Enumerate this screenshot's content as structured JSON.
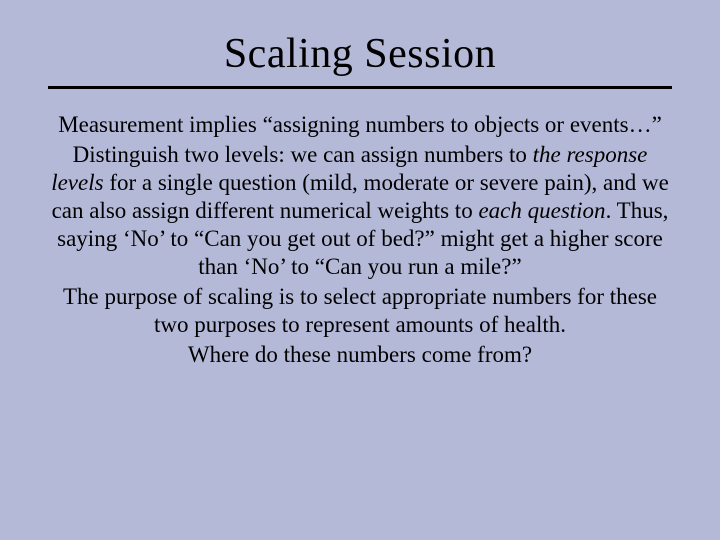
{
  "slide": {
    "title": "Scaling Session",
    "p1": "Measurement implies “assigning numbers to objects or events…”",
    "p2a": "Distinguish two levels: we can assign numbers to ",
    "p2b": "the response levels",
    "p2c": " for a single question (mild, moderate or severe pain), and we can also assign different numerical weights to ",
    "p2d": "each question",
    "p2e": ".  Thus, saying ‘No’ to “Can you get out of bed?” might get a higher score than ‘No’ to “Can you run a mile?”",
    "p3": "The purpose of scaling is to select appropriate numbers for these two purposes to represent amounts of health.",
    "p4": "Where do these numbers come from?"
  }
}
